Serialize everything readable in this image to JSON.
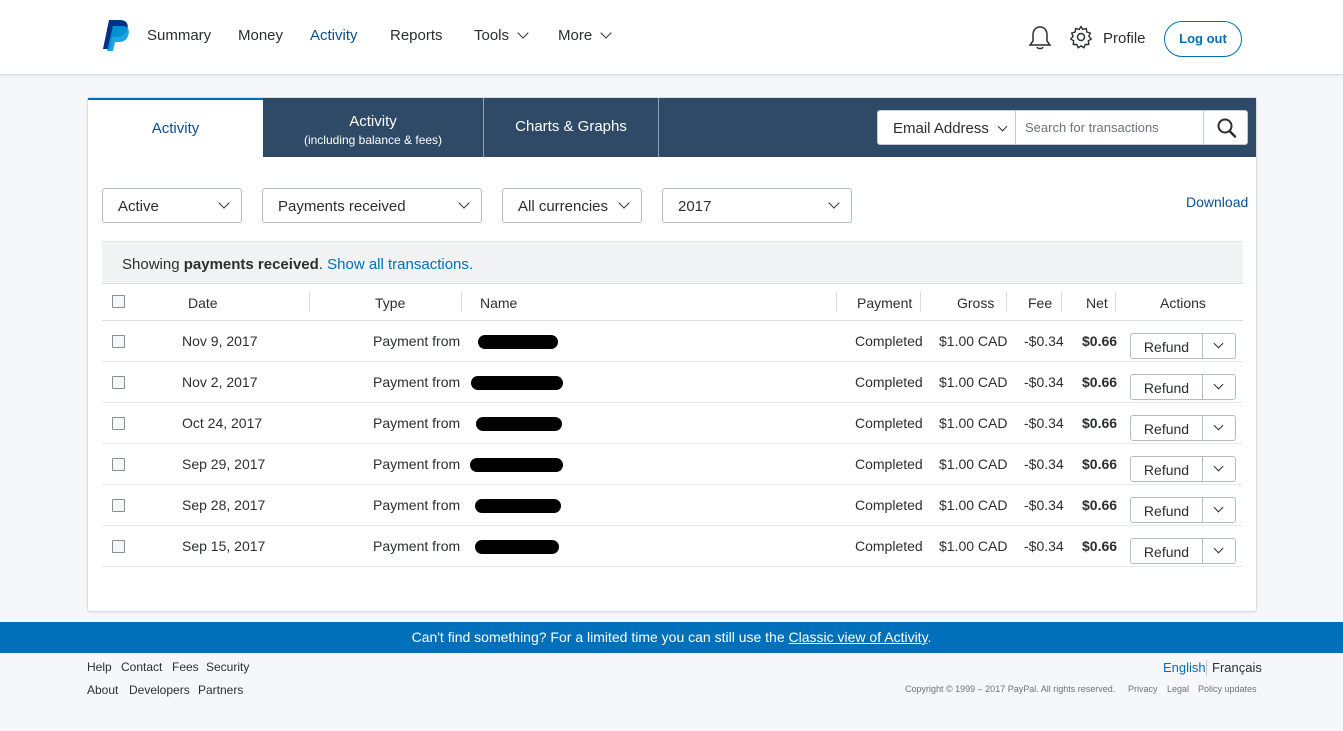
{
  "header": {
    "nav": [
      "Summary",
      "Money",
      "Activity",
      "Reports",
      "Tools",
      "More"
    ],
    "profile": "Profile",
    "logout": "Log out"
  },
  "tabs": {
    "activity": "Activity",
    "activity_fees": "Activity",
    "activity_fees_sub": "(including balance & fees)",
    "charts": "Charts & Graphs"
  },
  "search": {
    "type": "Email Address",
    "placeholder": "Search for transactions"
  },
  "filters": {
    "status": "Active",
    "type": "Payments received",
    "currency": "All currencies",
    "year": "2017",
    "download": "Download"
  },
  "notice": {
    "prefix": "Showing ",
    "bold": "payments received",
    "dot": ".",
    "link": "Show all transactions."
  },
  "columns": [
    "Date",
    "Type",
    "Name",
    "Payment",
    "Gross",
    "Fee",
    "Net",
    "Actions"
  ],
  "rows": [
    {
      "date": "Nov 9, 2017",
      "type": "Payment from",
      "status": "Completed",
      "gross": "$1.00 CAD",
      "fee": "-$0.34",
      "net": "$0.66",
      "action": "Refund"
    },
    {
      "date": "Nov 2, 2017",
      "type": "Payment from",
      "status": "Completed",
      "gross": "$1.00 CAD",
      "fee": "-$0.34",
      "net": "$0.66",
      "action": "Refund"
    },
    {
      "date": "Oct 24, 2017",
      "type": "Payment from",
      "status": "Completed",
      "gross": "$1.00 CAD",
      "fee": "-$0.34",
      "net": "$0.66",
      "action": "Refund"
    },
    {
      "date": "Sep 29, 2017",
      "type": "Payment from",
      "status": "Completed",
      "gross": "$1.00 CAD",
      "fee": "-$0.34",
      "net": "$0.66",
      "action": "Refund"
    },
    {
      "date": "Sep 28, 2017",
      "type": "Payment from",
      "status": "Completed",
      "gross": "$1.00 CAD",
      "fee": "-$0.34",
      "net": "$0.66",
      "action": "Refund"
    },
    {
      "date": "Sep 15, 2017",
      "type": "Payment from",
      "status": "Completed",
      "gross": "$1.00 CAD",
      "fee": "-$0.34",
      "net": "$0.66",
      "action": "Refund"
    }
  ],
  "banner": {
    "text": "Can't find something? For a limited time you can still use the ",
    "link": "Classic view of Activity",
    "end": "."
  },
  "footer": {
    "links1": [
      "Help",
      "Contact",
      "Fees",
      "Security"
    ],
    "links2": [
      "About",
      "Developers",
      "Partners"
    ],
    "lang_en": "English",
    "lang_fr": "Français",
    "copyright": "Copyright © 1999 – 2017 PayPal. All rights reserved.",
    "legal": [
      "Privacy",
      "Legal",
      "Policy updates"
    ]
  },
  "colors": {
    "brand_blue": "#0070ba",
    "tabbar": "#2f4a66",
    "banner": "#0070ba"
  },
  "icons": [
    "paypal-logo",
    "bell-icon",
    "gear-icon",
    "search-icon",
    "chevron-down-icon",
    "checkbox-icon"
  ]
}
